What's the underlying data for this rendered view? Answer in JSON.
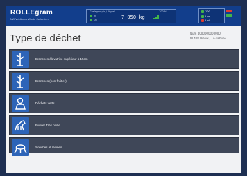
{
  "header": {
    "logo": "ROLLEgram",
    "logo_sub": "NW Veldkamp Waste Collection",
    "weigh_title": "Geslagen pic / Afgesl",
    "weigh_row1": "In",
    "weigh_row2": "Uit",
    "weigh_value": "7 050 kg",
    "weigh_right": "100 %",
    "status1": "100",
    "status2": "Live",
    "status3": "Link"
  },
  "page": {
    "title": "Type de déchet",
    "meta_line1": "Num 4000000000000",
    "meta_line2": "NL408 Nieuw / Ti - Tebuse"
  },
  "waste_types": [
    {
      "label": "Branches élévatrice supérieur à 15cm",
      "icon": "branch-icon"
    },
    {
      "label": "Branches (non-fruitier)",
      "icon": "branch-icon"
    },
    {
      "label": "Déchets verts",
      "icon": "green-waste-icon"
    },
    {
      "label": "Fumier Très paille",
      "icon": "horse-icon"
    },
    {
      "label": "Souches et racines",
      "icon": "stump-icon"
    }
  ],
  "colors": {
    "header_blue": "#123e8c",
    "icon_blue": "#2d64b8",
    "row_bg": "#3f4758",
    "status_green": "#43b64a",
    "status_red": "#e23b2e"
  }
}
